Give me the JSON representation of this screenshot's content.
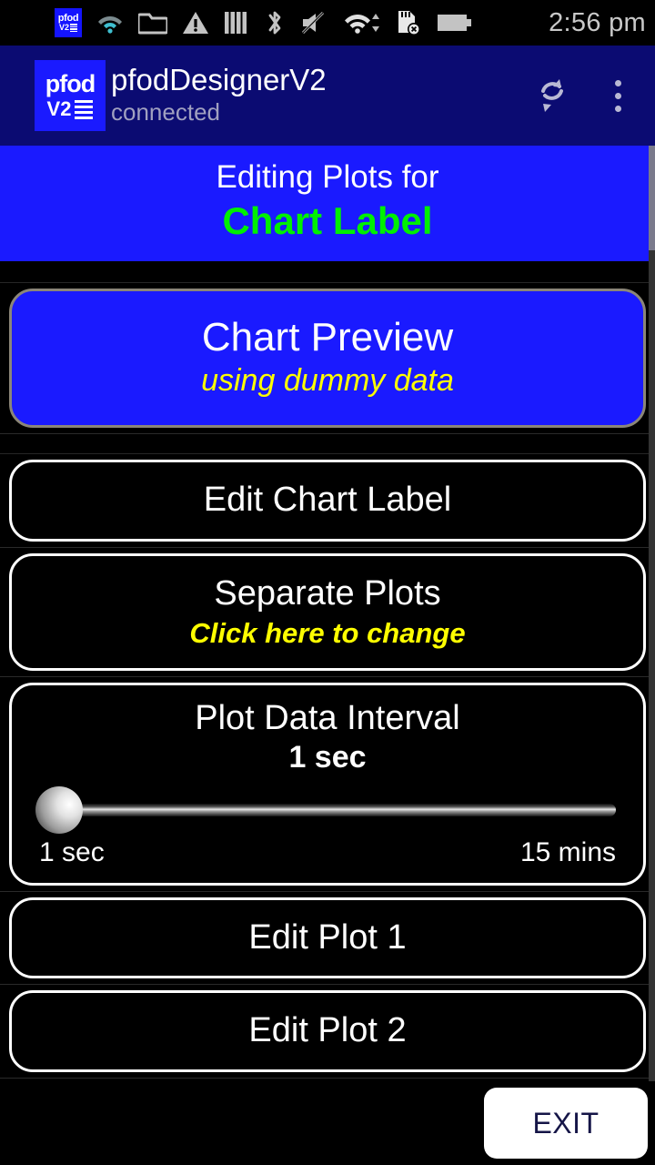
{
  "statusbar": {
    "icons": [
      {
        "name": "pfod-app-icon",
        "glyph": "pfod"
      },
      {
        "name": "wifi-weak-icon",
        "glyph": "wifi-small"
      },
      {
        "name": "folder-icon",
        "glyph": "folder"
      },
      {
        "name": "warning-icon",
        "glyph": "warning"
      },
      {
        "name": "signal-bars-icon",
        "glyph": "bars"
      },
      {
        "name": "bluetooth-icon",
        "glyph": "bluetooth"
      },
      {
        "name": "volume-muted-icon",
        "glyph": "mute"
      },
      {
        "name": "wifi-icon",
        "glyph": "wifi"
      },
      {
        "name": "sd-card-removed-icon",
        "glyph": "sdcard-x"
      },
      {
        "name": "battery-icon",
        "glyph": "battery"
      }
    ],
    "clock": "2:56 pm"
  },
  "appbar": {
    "logo_line1": "pfod",
    "logo_line2": "V2",
    "title": "pfodDesignerV2",
    "subtitle": "connected",
    "refresh_label": "refresh",
    "overflow_label": "more options"
  },
  "banner": {
    "line1": "Editing Plots for",
    "line2": "Chart Label"
  },
  "items": {
    "chart_preview": {
      "title": "Chart Preview",
      "subtitle": "using dummy data"
    },
    "edit_chart_label": {
      "title": "Edit Chart Label"
    },
    "separate_plots": {
      "title": "Separate Plots",
      "subtitle": "Click here to change"
    },
    "plot_data_interval": {
      "title": "Plot Data Interval",
      "value": "1 sec",
      "min_label": "1 sec",
      "max_label": "15 mins"
    },
    "edit_plot_1": {
      "title": "Edit Plot 1"
    },
    "edit_plot_2": {
      "title": "Edit Plot 2"
    }
  },
  "footer": {
    "exit_label": "EXIT"
  },
  "colors": {
    "appbar_bg": "#0b0b72",
    "banner_bg": "#1a1aff",
    "accent_green": "#00f000",
    "accent_yellow": "#ffff00",
    "preview_bg": "#1a1aff",
    "exit_text": "#151547"
  }
}
